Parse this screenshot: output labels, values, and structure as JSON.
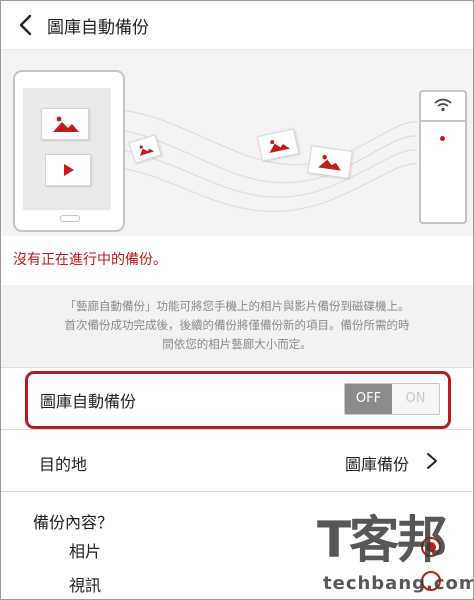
{
  "header": {
    "back_icon": "chevron-left-icon",
    "title": "圖庫自動備份"
  },
  "illustration": {
    "description_icons": [
      "phone-icon",
      "image-icon",
      "play-icon",
      "usb-drive-icon",
      "wifi-icon"
    ],
    "accent_color": "#c41a1a"
  },
  "status": {
    "text": "沒有正在進行中的備份。"
  },
  "description": {
    "lines": [
      "「藝廊自動備份」功能可將您手機上的相片與影片備份到磁碟機上。",
      "首次備份成功完成後，後續的備份將僅備份新的項目。備份所需的時",
      "間依您的相片藝廊大小而定。"
    ]
  },
  "auto_backup": {
    "label": "圖庫自動備份",
    "off_label": "OFF",
    "on_label": "ON",
    "state": "off",
    "highlight_color": "#b21c22"
  },
  "destination": {
    "label": "目的地",
    "value": "圖庫備份"
  },
  "content": {
    "label": "備份內容？",
    "options": [
      {
        "label": "相片",
        "checked": true
      },
      {
        "label": "視訊",
        "checked": false
      }
    ]
  },
  "watermark": {
    "brand": "T客邦",
    "site": "techbang.com"
  }
}
